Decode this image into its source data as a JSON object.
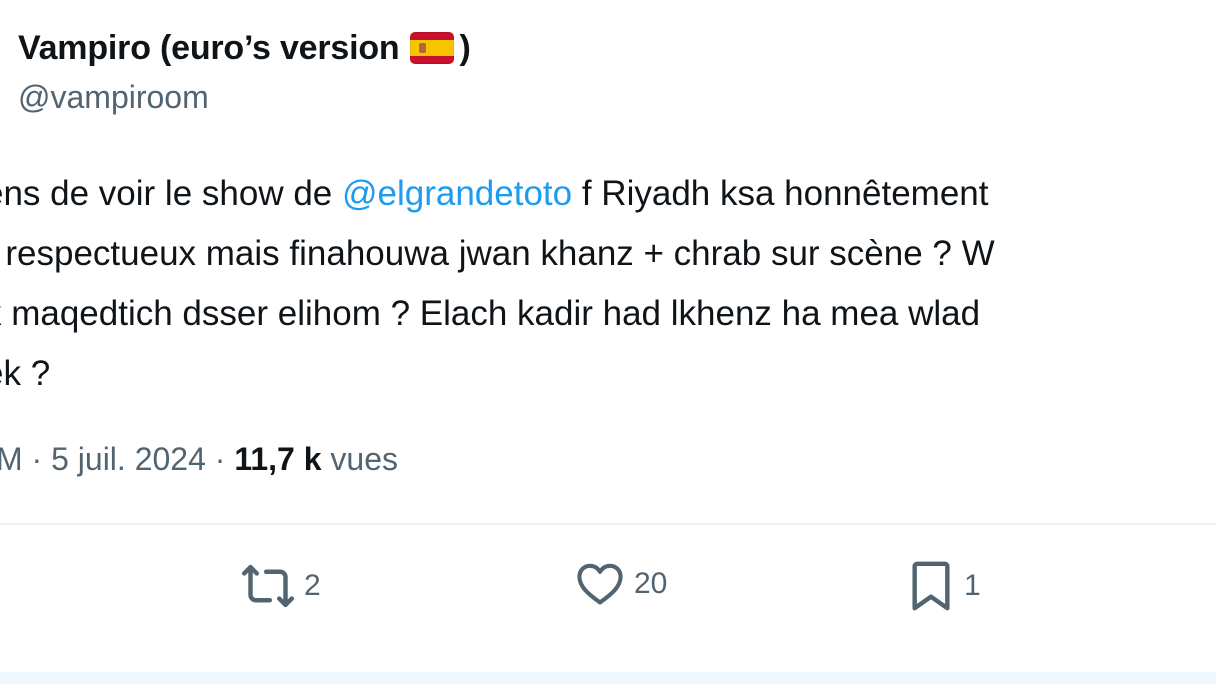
{
  "author": {
    "display_name_prefix": "Vampiro (euro’s version",
    "display_name_suffix": ")",
    "flag_icon": "spain-flag-icon",
    "handle": "@vampiroom"
  },
  "tweet": {
    "line1_before": "ens de voir le show de ",
    "mention": "@elgrandetoto",
    "line1_after": " f Riyadh ksa honnêtement",
    "line2": "r respectueux mais finahouwa jwan khanz + chrab sur scène ? W",
    "line3": "k maqedtich dsser elihom ? Elach kadir had lkhenz ha mea wlad",
    "line4": "ek ?"
  },
  "meta": {
    "time_fragment": "M",
    "separator": " · ",
    "date": "5 juil. 2024",
    "views_count": "11,7 k",
    "views_label": " vues"
  },
  "actions": {
    "retweets": "2",
    "likes": "20",
    "bookmarks": "1"
  },
  "colors": {
    "accent": "#1d9bf0",
    "text_primary": "#0f1419",
    "text_secondary": "#536471",
    "divider": "#eff3f4"
  }
}
